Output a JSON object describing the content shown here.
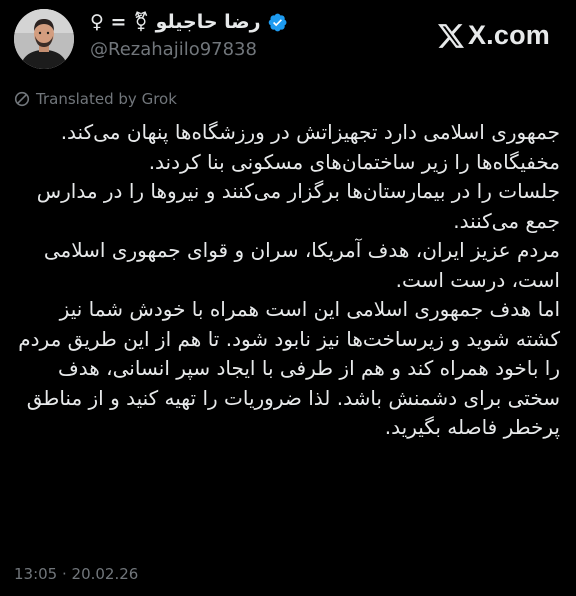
{
  "post": {
    "author": {
      "display_name": "رضا حاجیلو ⚧ = ♀",
      "handle": "@Rezahajilo97838",
      "verified": true,
      "verified_color": "#1d9bf0"
    },
    "source_brand": "X.com",
    "translation_label": "Translated by Grok",
    "body": [
      "جمهوری اسلامی دارد تجهیزاتش در ورزشگاه‌ها پنهان می‌کند.",
      "مخفیگاه‌ها را زیر ساختمان‌های مسکونی بنا کردند.",
      "جلسات را در بیمارستان‌ها برگزار می‌کنند و نیروها را در مدارس جمع می‌کنند.",
      "مردم عزیز ایران، هدف آمریکا، سران و قوای جمهوری اسلامی است، درست است.",
      "اما هدف جمهوری اسلامی این است همراه با خودش شما نیز کشته شوید و زیرساخت‌ها نیز نابود شود. تا هم از این طریق مردم را باخود همراه کند و هم از طرفی با ایجاد سپر انسانی، هدف سختی برای دشمنش باشد. لذا ضروریات را تهیه کنید و از مناطق پرخطر فاصله بگیرید."
    ],
    "timestamp": "13:05 · 20.02.26"
  },
  "icons": {
    "avatar": "profile-photo",
    "verified": "verified-badge-icon",
    "brand": "x-logo-icon",
    "translation": "grok-icon"
  },
  "colors": {
    "background": "#000000",
    "primary_text": "#e7e9ea",
    "secondary_text": "#71767b",
    "accent": "#1d9bf0"
  }
}
